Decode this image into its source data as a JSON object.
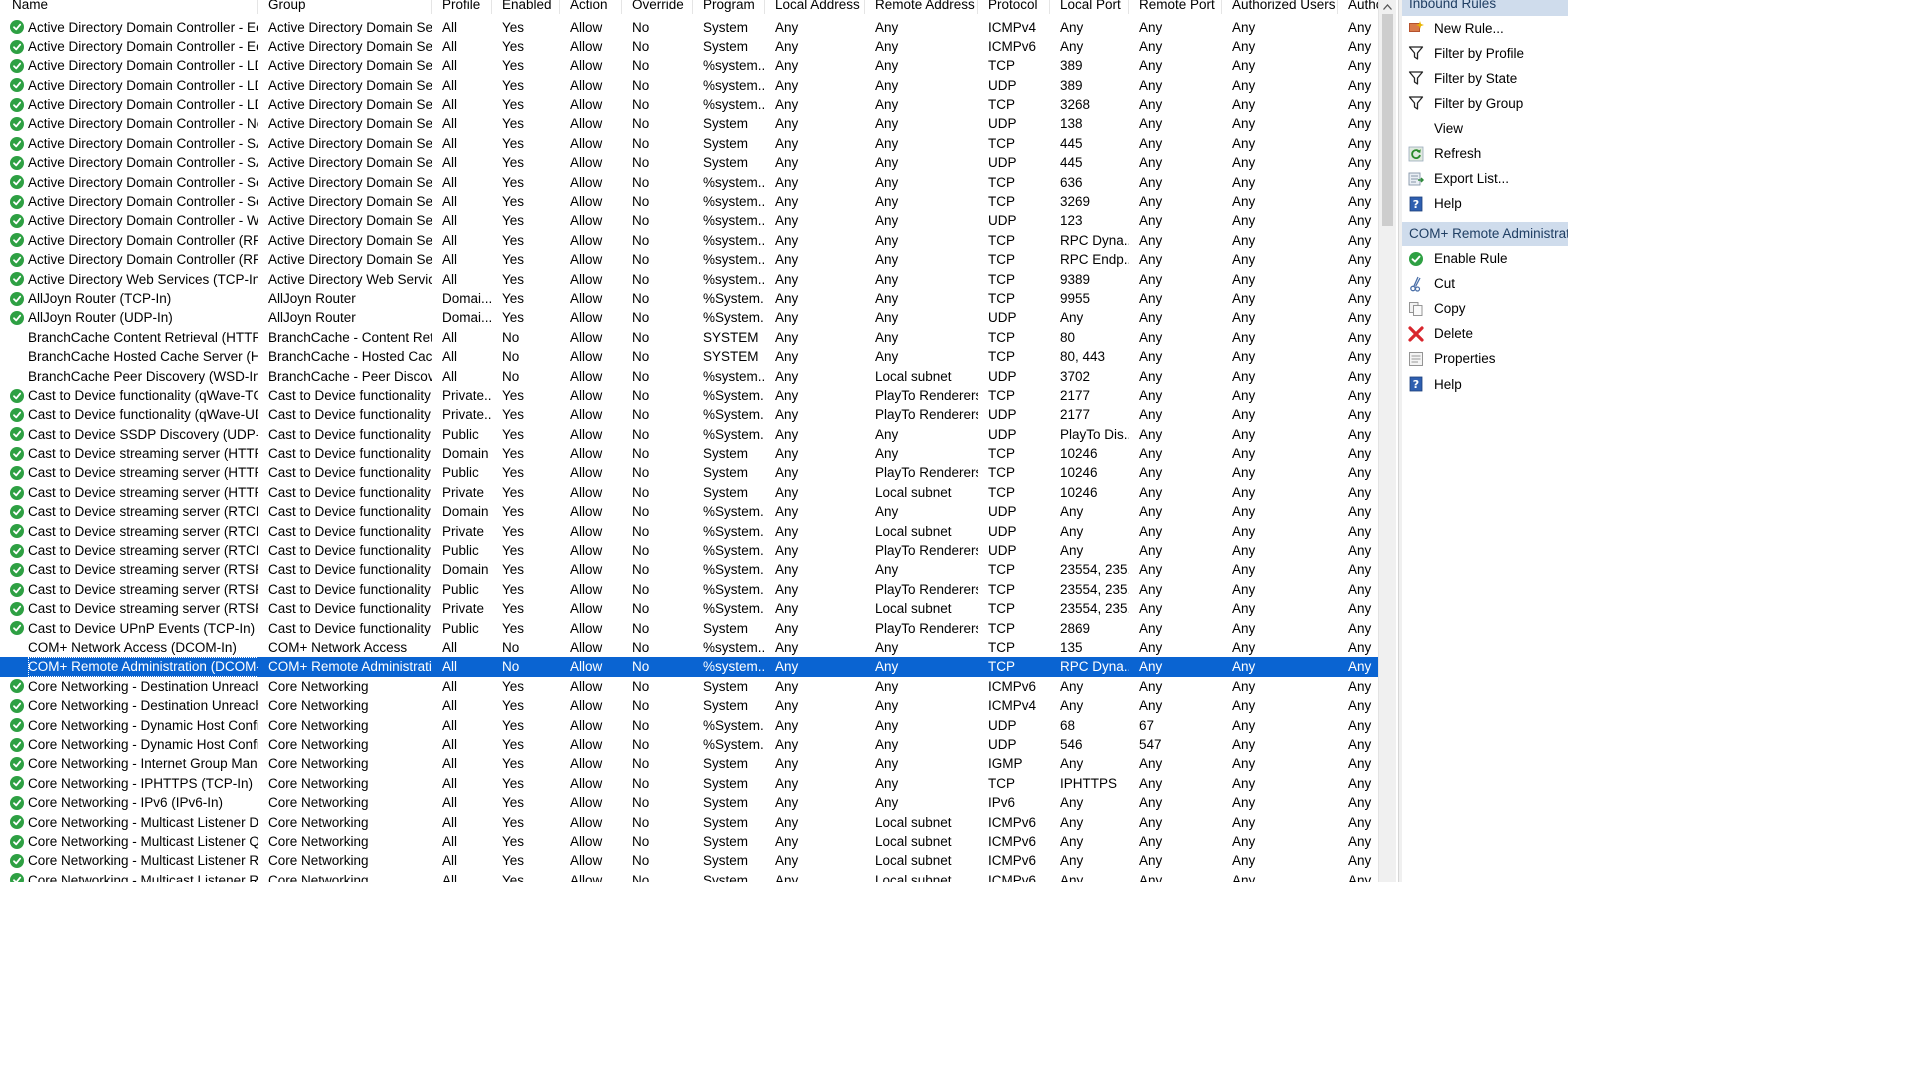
{
  "columns": [
    "Name",
    "Group",
    "Profile",
    "Enabled",
    "Action",
    "Override",
    "Program",
    "Local Address",
    "Remote Address",
    "Protocol",
    "Local Port",
    "Remote Port",
    "Authorized Users",
    "Authc"
  ],
  "rows": [
    {
      "enabled_icon": true,
      "cells": [
        "Active Directory Domain Controller - Ec...",
        "Active Directory Domain Ser...",
        "All",
        "Yes",
        "Allow",
        "No",
        "System",
        "Any",
        "Any",
        "ICMPv4",
        "Any",
        "Any",
        "Any",
        "Any"
      ]
    },
    {
      "enabled_icon": true,
      "cells": [
        "Active Directory Domain Controller - Ec...",
        "Active Directory Domain Ser...",
        "All",
        "Yes",
        "Allow",
        "No",
        "System",
        "Any",
        "Any",
        "ICMPv6",
        "Any",
        "Any",
        "Any",
        "Any"
      ]
    },
    {
      "enabled_icon": true,
      "cells": [
        "Active Directory Domain Controller - LD...",
        "Active Directory Domain Ser...",
        "All",
        "Yes",
        "Allow",
        "No",
        "%system...",
        "Any",
        "Any",
        "TCP",
        "389",
        "Any",
        "Any",
        "Any"
      ]
    },
    {
      "enabled_icon": true,
      "cells": [
        "Active Directory Domain Controller - LD...",
        "Active Directory Domain Ser...",
        "All",
        "Yes",
        "Allow",
        "No",
        "%system...",
        "Any",
        "Any",
        "UDP",
        "389",
        "Any",
        "Any",
        "Any"
      ]
    },
    {
      "enabled_icon": true,
      "cells": [
        "Active Directory Domain Controller - LD...",
        "Active Directory Domain Ser...",
        "All",
        "Yes",
        "Allow",
        "No",
        "%system...",
        "Any",
        "Any",
        "TCP",
        "3268",
        "Any",
        "Any",
        "Any"
      ]
    },
    {
      "enabled_icon": true,
      "cells": [
        "Active Directory Domain Controller - Net...",
        "Active Directory Domain Ser...",
        "All",
        "Yes",
        "Allow",
        "No",
        "System",
        "Any",
        "Any",
        "UDP",
        "138",
        "Any",
        "Any",
        "Any"
      ]
    },
    {
      "enabled_icon": true,
      "cells": [
        "Active Directory Domain Controller - SA...",
        "Active Directory Domain Ser...",
        "All",
        "Yes",
        "Allow",
        "No",
        "System",
        "Any",
        "Any",
        "TCP",
        "445",
        "Any",
        "Any",
        "Any"
      ]
    },
    {
      "enabled_icon": true,
      "cells": [
        "Active Directory Domain Controller - SA...",
        "Active Directory Domain Ser...",
        "All",
        "Yes",
        "Allow",
        "No",
        "System",
        "Any",
        "Any",
        "UDP",
        "445",
        "Any",
        "Any",
        "Any"
      ]
    },
    {
      "enabled_icon": true,
      "cells": [
        "Active Directory Domain Controller - Sec...",
        "Active Directory Domain Ser...",
        "All",
        "Yes",
        "Allow",
        "No",
        "%system...",
        "Any",
        "Any",
        "TCP",
        "636",
        "Any",
        "Any",
        "Any"
      ]
    },
    {
      "enabled_icon": true,
      "cells": [
        "Active Directory Domain Controller - Sec...",
        "Active Directory Domain Ser...",
        "All",
        "Yes",
        "Allow",
        "No",
        "%system...",
        "Any",
        "Any",
        "TCP",
        "3269",
        "Any",
        "Any",
        "Any"
      ]
    },
    {
      "enabled_icon": true,
      "cells": [
        "Active Directory Domain Controller - W3...",
        "Active Directory Domain Ser...",
        "All",
        "Yes",
        "Allow",
        "No",
        "%system...",
        "Any",
        "Any",
        "UDP",
        "123",
        "Any",
        "Any",
        "Any"
      ]
    },
    {
      "enabled_icon": true,
      "cells": [
        "Active Directory Domain Controller (RPC)",
        "Active Directory Domain Ser...",
        "All",
        "Yes",
        "Allow",
        "No",
        "%system...",
        "Any",
        "Any",
        "TCP",
        "RPC Dyna...",
        "Any",
        "Any",
        "Any"
      ]
    },
    {
      "enabled_icon": true,
      "cells": [
        "Active Directory Domain Controller (RPC...",
        "Active Directory Domain Ser...",
        "All",
        "Yes",
        "Allow",
        "No",
        "%system...",
        "Any",
        "Any",
        "TCP",
        "RPC Endp...",
        "Any",
        "Any",
        "Any"
      ]
    },
    {
      "enabled_icon": true,
      "cells": [
        "Active Directory Web Services (TCP-In)",
        "Active Directory Web Services",
        "All",
        "Yes",
        "Allow",
        "No",
        "%system...",
        "Any",
        "Any",
        "TCP",
        "9389",
        "Any",
        "Any",
        "Any"
      ]
    },
    {
      "enabled_icon": true,
      "cells": [
        "AllJoyn Router (TCP-In)",
        "AllJoyn Router",
        "Domai...",
        "Yes",
        "Allow",
        "No",
        "%System...",
        "Any",
        "Any",
        "TCP",
        "9955",
        "Any",
        "Any",
        "Any"
      ]
    },
    {
      "enabled_icon": true,
      "cells": [
        "AllJoyn Router (UDP-In)",
        "AllJoyn Router",
        "Domai...",
        "Yes",
        "Allow",
        "No",
        "%System...",
        "Any",
        "Any",
        "UDP",
        "Any",
        "Any",
        "Any",
        "Any"
      ]
    },
    {
      "enabled_icon": false,
      "cells": [
        "BranchCache Content Retrieval (HTTP-In)",
        "BranchCache - Content Retr...",
        "All",
        "No",
        "Allow",
        "No",
        "SYSTEM",
        "Any",
        "Any",
        "TCP",
        "80",
        "Any",
        "Any",
        "Any"
      ]
    },
    {
      "enabled_icon": false,
      "cells": [
        "BranchCache Hosted Cache Server (HTTP...",
        "BranchCache - Hosted Cach...",
        "All",
        "No",
        "Allow",
        "No",
        "SYSTEM",
        "Any",
        "Any",
        "TCP",
        "80, 443",
        "Any",
        "Any",
        "Any"
      ]
    },
    {
      "enabled_icon": false,
      "cells": [
        "BranchCache Peer Discovery (WSD-In)",
        "BranchCache - Peer Discove...",
        "All",
        "No",
        "Allow",
        "No",
        "%system...",
        "Any",
        "Local subnet",
        "UDP",
        "3702",
        "Any",
        "Any",
        "Any"
      ]
    },
    {
      "enabled_icon": true,
      "cells": [
        "Cast to Device functionality (qWave-TCP...",
        "Cast to Device functionality",
        "Private...",
        "Yes",
        "Allow",
        "No",
        "%System...",
        "Any",
        "PlayTo Renderers",
        "TCP",
        "2177",
        "Any",
        "Any",
        "Any"
      ]
    },
    {
      "enabled_icon": true,
      "cells": [
        "Cast to Device functionality (qWave-UDP...",
        "Cast to Device functionality",
        "Private...",
        "Yes",
        "Allow",
        "No",
        "%System...",
        "Any",
        "PlayTo Renderers",
        "UDP",
        "2177",
        "Any",
        "Any",
        "Any"
      ]
    },
    {
      "enabled_icon": true,
      "cells": [
        "Cast to Device SSDP Discovery (UDP-In)",
        "Cast to Device functionality",
        "Public",
        "Yes",
        "Allow",
        "No",
        "%System...",
        "Any",
        "Any",
        "UDP",
        "PlayTo Dis...",
        "Any",
        "Any",
        "Any"
      ]
    },
    {
      "enabled_icon": true,
      "cells": [
        "Cast to Device streaming server (HTTP-St...",
        "Cast to Device functionality",
        "Domain",
        "Yes",
        "Allow",
        "No",
        "System",
        "Any",
        "Any",
        "TCP",
        "10246",
        "Any",
        "Any",
        "Any"
      ]
    },
    {
      "enabled_icon": true,
      "cells": [
        "Cast to Device streaming server (HTTP-St...",
        "Cast to Device functionality",
        "Public",
        "Yes",
        "Allow",
        "No",
        "System",
        "Any",
        "PlayTo Renderers",
        "TCP",
        "10246",
        "Any",
        "Any",
        "Any"
      ]
    },
    {
      "enabled_icon": true,
      "cells": [
        "Cast to Device streaming server (HTTP-St...",
        "Cast to Device functionality",
        "Private",
        "Yes",
        "Allow",
        "No",
        "System",
        "Any",
        "Local subnet",
        "TCP",
        "10246",
        "Any",
        "Any",
        "Any"
      ]
    },
    {
      "enabled_icon": true,
      "cells": [
        "Cast to Device streaming server (RTCP-Str...",
        "Cast to Device functionality",
        "Domain",
        "Yes",
        "Allow",
        "No",
        "%System...",
        "Any",
        "Any",
        "UDP",
        "Any",
        "Any",
        "Any",
        "Any"
      ]
    },
    {
      "enabled_icon": true,
      "cells": [
        "Cast to Device streaming server (RTCP-Str...",
        "Cast to Device functionality",
        "Private",
        "Yes",
        "Allow",
        "No",
        "%System...",
        "Any",
        "Local subnet",
        "UDP",
        "Any",
        "Any",
        "Any",
        "Any"
      ]
    },
    {
      "enabled_icon": true,
      "cells": [
        "Cast to Device streaming server (RTCP-Str...",
        "Cast to Device functionality",
        "Public",
        "Yes",
        "Allow",
        "No",
        "%System...",
        "Any",
        "PlayTo Renderers",
        "UDP",
        "Any",
        "Any",
        "Any",
        "Any"
      ]
    },
    {
      "enabled_icon": true,
      "cells": [
        "Cast to Device streaming server (RTSP-Str...",
        "Cast to Device functionality",
        "Domain",
        "Yes",
        "Allow",
        "No",
        "%System...",
        "Any",
        "Any",
        "TCP",
        "23554, 235...",
        "Any",
        "Any",
        "Any"
      ]
    },
    {
      "enabled_icon": true,
      "cells": [
        "Cast to Device streaming server (RTSP-Str...",
        "Cast to Device functionality",
        "Public",
        "Yes",
        "Allow",
        "No",
        "%System...",
        "Any",
        "PlayTo Renderers",
        "TCP",
        "23554, 235...",
        "Any",
        "Any",
        "Any"
      ]
    },
    {
      "enabled_icon": true,
      "cells": [
        "Cast to Device streaming server (RTSP-Str...",
        "Cast to Device functionality",
        "Private",
        "Yes",
        "Allow",
        "No",
        "%System...",
        "Any",
        "Local subnet",
        "TCP",
        "23554, 235...",
        "Any",
        "Any",
        "Any"
      ]
    },
    {
      "enabled_icon": true,
      "cells": [
        "Cast to Device UPnP Events (TCP-In)",
        "Cast to Device functionality",
        "Public",
        "Yes",
        "Allow",
        "No",
        "System",
        "Any",
        "PlayTo Renderers",
        "TCP",
        "2869",
        "Any",
        "Any",
        "Any"
      ]
    },
    {
      "enabled_icon": false,
      "cells": [
        "COM+ Network Access (DCOM-In)",
        "COM+ Network Access",
        "All",
        "No",
        "Allow",
        "No",
        "%system...",
        "Any",
        "Any",
        "TCP",
        "135",
        "Any",
        "Any",
        "Any"
      ]
    },
    {
      "enabled_icon": false,
      "selected": true,
      "cells": [
        "COM+ Remote Administration (DCOM-In)",
        "COM+ Remote Administrati...",
        "All",
        "No",
        "Allow",
        "No",
        "%system...",
        "Any",
        "Any",
        "TCP",
        "RPC Dyna...",
        "Any",
        "Any",
        "Any"
      ]
    },
    {
      "enabled_icon": true,
      "cells": [
        "Core Networking - Destination Unreacha...",
        "Core Networking",
        "All",
        "Yes",
        "Allow",
        "No",
        "System",
        "Any",
        "Any",
        "ICMPv6",
        "Any",
        "Any",
        "Any",
        "Any"
      ]
    },
    {
      "enabled_icon": true,
      "cells": [
        "Core Networking - Destination Unreacha...",
        "Core Networking",
        "All",
        "Yes",
        "Allow",
        "No",
        "System",
        "Any",
        "Any",
        "ICMPv4",
        "Any",
        "Any",
        "Any",
        "Any"
      ]
    },
    {
      "enabled_icon": true,
      "cells": [
        "Core Networking - Dynamic Host Config...",
        "Core Networking",
        "All",
        "Yes",
        "Allow",
        "No",
        "%System...",
        "Any",
        "Any",
        "UDP",
        "68",
        "67",
        "Any",
        "Any"
      ]
    },
    {
      "enabled_icon": true,
      "cells": [
        "Core Networking - Dynamic Host Config...",
        "Core Networking",
        "All",
        "Yes",
        "Allow",
        "No",
        "%System...",
        "Any",
        "Any",
        "UDP",
        "546",
        "547",
        "Any",
        "Any"
      ]
    },
    {
      "enabled_icon": true,
      "cells": [
        "Core Networking - Internet Group Mana...",
        "Core Networking",
        "All",
        "Yes",
        "Allow",
        "No",
        "System",
        "Any",
        "Any",
        "IGMP",
        "Any",
        "Any",
        "Any",
        "Any"
      ]
    },
    {
      "enabled_icon": true,
      "cells": [
        "Core Networking - IPHTTPS (TCP-In)",
        "Core Networking",
        "All",
        "Yes",
        "Allow",
        "No",
        "System",
        "Any",
        "Any",
        "TCP",
        "IPHTTPS",
        "Any",
        "Any",
        "Any"
      ]
    },
    {
      "enabled_icon": true,
      "cells": [
        "Core Networking - IPv6 (IPv6-In)",
        "Core Networking",
        "All",
        "Yes",
        "Allow",
        "No",
        "System",
        "Any",
        "Any",
        "IPv6",
        "Any",
        "Any",
        "Any",
        "Any"
      ]
    },
    {
      "enabled_icon": true,
      "cells": [
        "Core Networking - Multicast Listener Do...",
        "Core Networking",
        "All",
        "Yes",
        "Allow",
        "No",
        "System",
        "Any",
        "Local subnet",
        "ICMPv6",
        "Any",
        "Any",
        "Any",
        "Any"
      ]
    },
    {
      "enabled_icon": true,
      "cells": [
        "Core Networking - Multicast Listener Qu...",
        "Core Networking",
        "All",
        "Yes",
        "Allow",
        "No",
        "System",
        "Any",
        "Local subnet",
        "ICMPv6",
        "Any",
        "Any",
        "Any",
        "Any"
      ]
    },
    {
      "enabled_icon": true,
      "cells": [
        "Core Networking - Multicast Listener Rep...",
        "Core Networking",
        "All",
        "Yes",
        "Allow",
        "No",
        "System",
        "Any",
        "Local subnet",
        "ICMPv6",
        "Any",
        "Any",
        "Any",
        "Any"
      ]
    },
    {
      "enabled_icon": true,
      "cells": [
        "Core Networking - Multicast Listener Rep...",
        "Core Networking",
        "All",
        "Yes",
        "Allow",
        "No",
        "System",
        "Any",
        "Local subnet",
        "ICMPv6",
        "Any",
        "Any",
        "Any",
        "Any"
      ]
    }
  ],
  "actions": {
    "inbound_title": "Inbound Rules",
    "inbound": [
      {
        "label": "New Rule...",
        "icon": "new-rule-icon"
      },
      {
        "label": "Filter by Profile",
        "icon": "filter-icon"
      },
      {
        "label": "Filter by State",
        "icon": "filter-icon"
      },
      {
        "label": "Filter by Group",
        "icon": "filter-icon"
      },
      {
        "label": "View",
        "icon": ""
      },
      {
        "label": "Refresh",
        "icon": "refresh-icon"
      },
      {
        "label": "Export List...",
        "icon": "export-icon"
      },
      {
        "label": "Help",
        "icon": "help-icon"
      }
    ],
    "selected_title": "COM+ Remote Administration (DCOM-In)",
    "selected": [
      {
        "label": "Enable Rule",
        "icon": "enable-rule-icon"
      },
      {
        "label": "Cut",
        "icon": "cut-icon"
      },
      {
        "label": "Copy",
        "icon": "copy-icon"
      },
      {
        "label": "Delete",
        "icon": "delete-icon"
      },
      {
        "label": "Properties",
        "icon": "properties-icon"
      },
      {
        "label": "Help",
        "icon": "help-icon"
      }
    ]
  },
  "colors": {
    "selection": "#0a64d2",
    "enabled_check": "#2ea043",
    "action_header_bg": "#cfdcec",
    "action_header_text": "#1f3e63"
  }
}
